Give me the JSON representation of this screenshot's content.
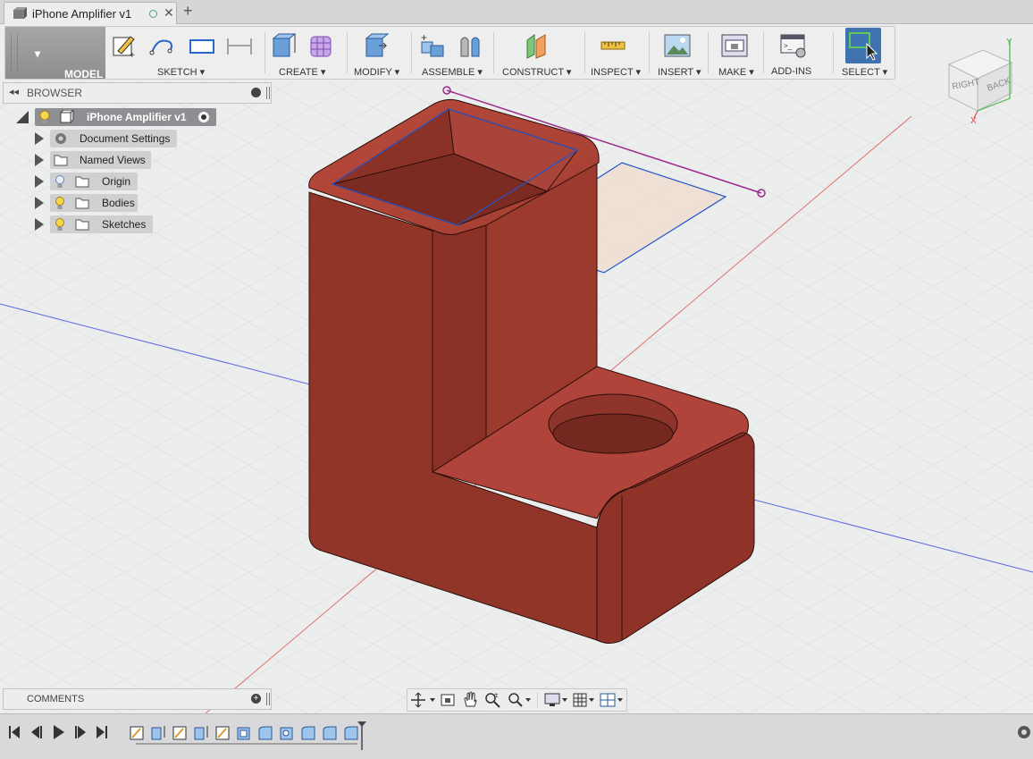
{
  "document": {
    "tab_title": "iPhone Amplifier v1"
  },
  "toolbar": {
    "workspace": "MODEL",
    "groups": [
      "SKETCH",
      "CREATE",
      "MODIFY",
      "ASSEMBLE",
      "CONSTRUCT",
      "INSPECT",
      "INSERT",
      "MAKE",
      "ADD-INS",
      "SELECT"
    ]
  },
  "browser": {
    "title": "BROWSER",
    "root": "iPhone Amplifier v1",
    "items": [
      "Document Settings",
      "Named Views",
      "Origin",
      "Bodies",
      "Sketches"
    ]
  },
  "viewcube": {
    "faces": [
      "RIGHT",
      "BACK"
    ],
    "axes": [
      "X",
      "Y"
    ]
  },
  "comments": {
    "title": "COMMENTS"
  },
  "colors": {
    "body": "#9a3a30",
    "accent": "#3f73b0",
    "sketch_line": "#2255cc",
    "construction": "#9a2a8c"
  },
  "icons": [
    "sketch-icon",
    "arc-icon",
    "rectangle-icon",
    "dimension-icon",
    "extrude-icon",
    "form-icon",
    "press-pull-icon",
    "new-component-icon",
    "joint-icon",
    "offset-plane-icon",
    "measure-icon",
    "decal-icon",
    "print-icon",
    "scripts-icon",
    "select-icon",
    "orbit-icon",
    "look-at-icon",
    "pan-icon",
    "zoom-icon",
    "fit-icon",
    "display-icon",
    "grid-icon",
    "viewports-icon",
    "gear-icon"
  ]
}
